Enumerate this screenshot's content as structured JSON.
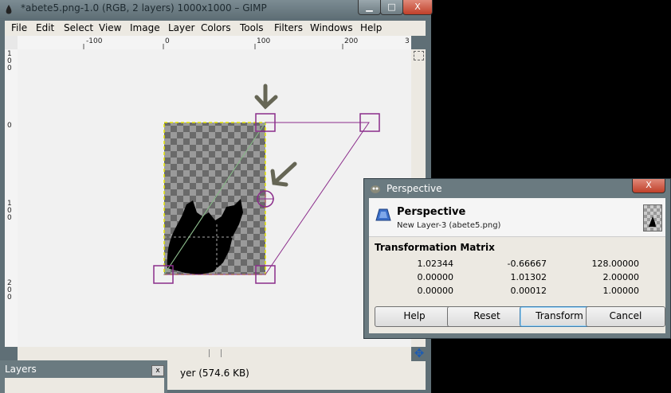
{
  "window": {
    "title": "*abete5.png-1.0 (RGB, 2 layers) 1000x1000 – GIMP",
    "minimize": "▁",
    "maximize": "□",
    "close": "X"
  },
  "menu": [
    "File",
    "Edit",
    "Select",
    "View",
    "Image",
    "Layer",
    "Colors",
    "Tools",
    "Filters",
    "Windows",
    "Help"
  ],
  "ruler": {
    "h": [
      "-100",
      "0",
      "100",
      "200",
      "3"
    ],
    "v": [
      "1\n0\n0",
      "0",
      "1\n0\n0",
      "2\n0\n0"
    ]
  },
  "status": {
    "text": "yer (574.6 KB)"
  },
  "layers": {
    "title": "Layers",
    "close": "x"
  },
  "dialog": {
    "title": "Perspective",
    "heading": "Perspective",
    "subtitle": "New Layer-3 (abete5.png)",
    "matrix_label": "Transformation Matrix",
    "matrix": [
      [
        "1.02344",
        "-0.66667",
        "128.00000"
      ],
      [
        "0.00000",
        "1.01302",
        "2.00000"
      ],
      [
        "0.00000",
        "0.00012",
        "1.00000"
      ]
    ],
    "buttons": {
      "help": "Help",
      "reset": "Reset",
      "transform": "Transform",
      "cancel": "Cancel"
    },
    "close": "X"
  }
}
